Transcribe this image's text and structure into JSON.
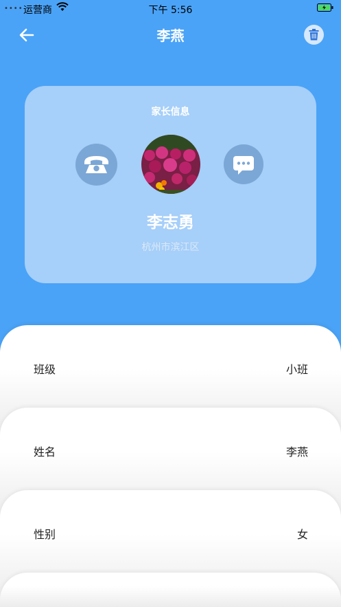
{
  "status_bar": {
    "signal": "••••",
    "carrier": "运营商",
    "time": "下午 5:56"
  },
  "nav": {
    "title": "李燕"
  },
  "parent_card": {
    "heading": "家长信息",
    "name": "李志勇",
    "address": "杭州市滨江区"
  },
  "info_rows": [
    {
      "label": "班级",
      "value": "小班"
    },
    {
      "label": "姓名",
      "value": "李燕"
    },
    {
      "label": "性别",
      "value": "女"
    },
    {
      "label": "",
      "value": ""
    }
  ],
  "colors": {
    "primary": "#4aa3f7",
    "card": "#a6cff9",
    "icon_circle": "#7ba7d6"
  }
}
